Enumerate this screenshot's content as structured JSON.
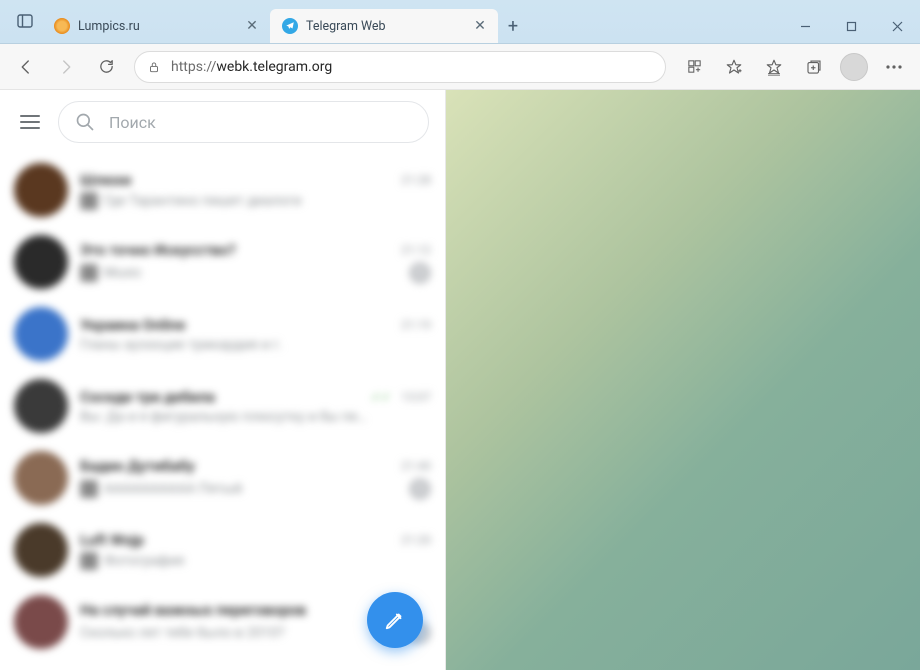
{
  "browser": {
    "tabs": [
      {
        "title": "Lumpics.ru",
        "active": false
      },
      {
        "title": "Telegram Web",
        "active": true
      }
    ],
    "url_proto": "https://",
    "url_domain": "webk.telegram.org",
    "url_path": ""
  },
  "telegram": {
    "search_placeholder": "Поиск",
    "chats": [
      {
        "name": "Шлюхи",
        "msg": "Где Тарантино пишет диалоги",
        "time": "21:28",
        "avatar_bg": "#5a3820",
        "thumb": true,
        "badge": null
      },
      {
        "name": "Это точно Искусство?",
        "msg": "Music",
        "time": "21:12",
        "avatar_bg": "#2a2a2a",
        "thumb": true,
        "badge": "1"
      },
      {
        "name": "Украина Online",
        "msg": "Гланы ауэзоцие трикардия и г.",
        "time": "21:19",
        "avatar_bg": "#3b74c9",
        "thumb": false,
        "badge": null
      },
      {
        "name": "Соседи три дебила",
        "msg": "Вы: Да и я фигуральную плюсутку и бы пе…",
        "time": "13:07",
        "avatar_bg": "#3a3a3a",
        "thumb": false,
        "badge": null,
        "sent": true
      },
      {
        "name": "Бадин Дутибабу",
        "msg": "АААААААААА Пятый",
        "time": "21:40",
        "avatar_bg": "#8a6a54",
        "thumb": true,
        "badge": "1"
      },
      {
        "name": "Luft Wojp",
        "msg": "Фотография",
        "time": "21:20",
        "avatar_bg": "#4a3a2a",
        "thumb": true,
        "badge": null
      },
      {
        "name": "На случай важных переговоров",
        "msg": "Сколько лет тебе было в 2010?",
        "time": "",
        "avatar_bg": "#7a4a4a",
        "thumb": false,
        "badge": "12"
      }
    ]
  }
}
